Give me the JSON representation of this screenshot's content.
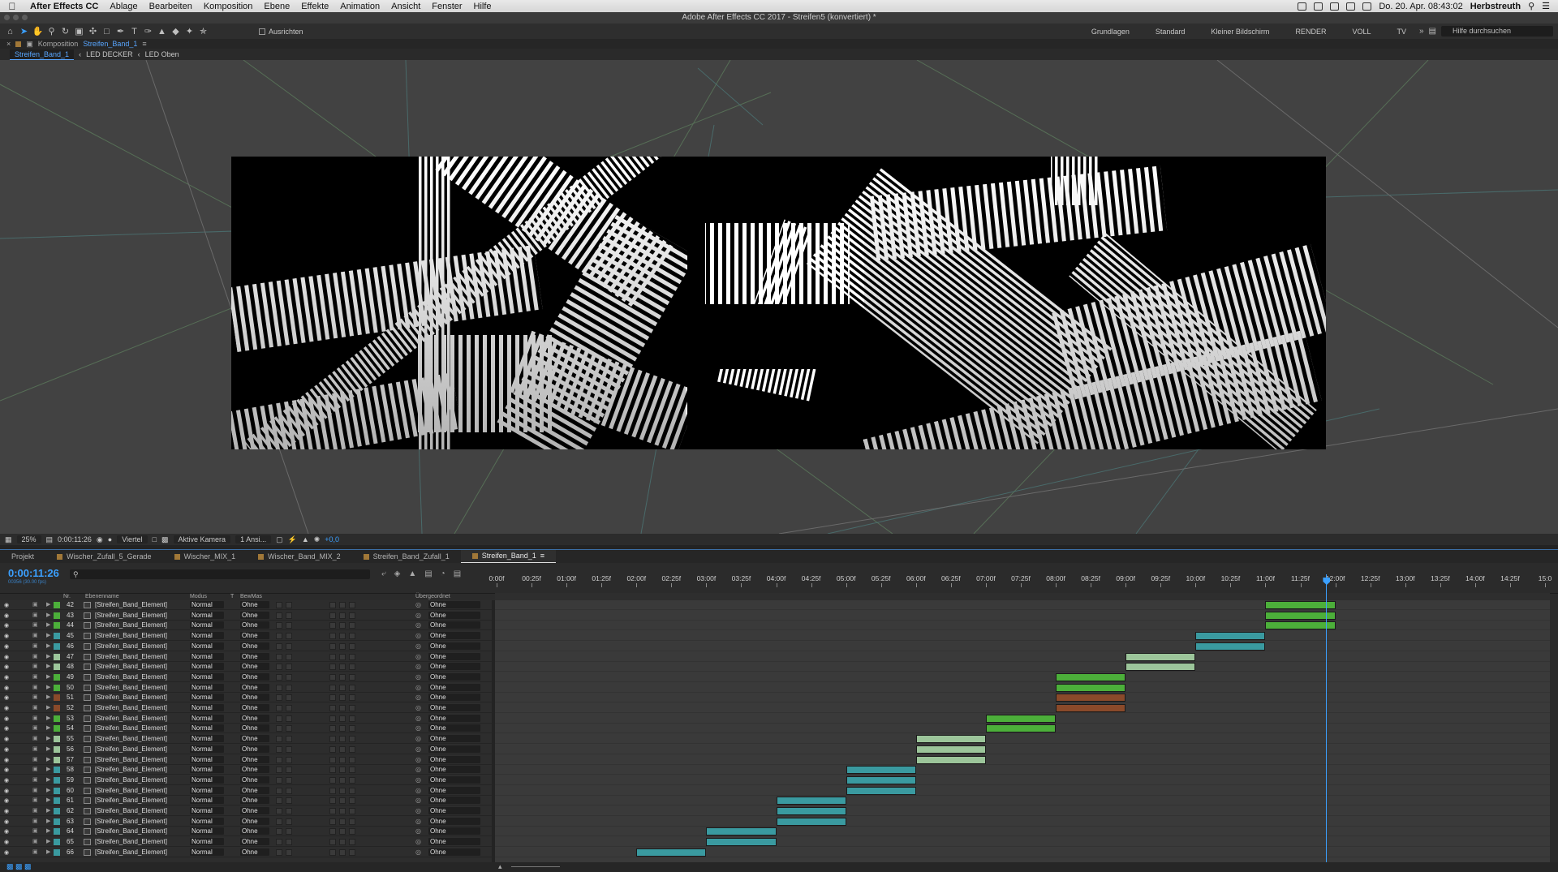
{
  "menubar": {
    "items": [
      "After Effects CC",
      "Ablage",
      "Bearbeiten",
      "Komposition",
      "Ebene",
      "Effekte",
      "Animation",
      "Ansicht",
      "Fenster",
      "Hilfe"
    ],
    "clock": "Do. 20. Apr.  08:43:02",
    "user": "Herbstreuth"
  },
  "window_title": "Adobe After Effects CC 2017 - Streifen5 (konvertiert) *",
  "toolbar": {
    "align_label": "Ausrichten",
    "workspaces": [
      "Grundlagen",
      "Standard",
      "Kleiner Bildschirm",
      "RENDER",
      "VOLL",
      "TV"
    ],
    "help_placeholder": "Hilfe durchsuchen"
  },
  "comp_panel": {
    "label": "Komposition",
    "name": "Streifen_Band_1",
    "breadcrumbs": [
      "Streifen_Band_1",
      "LED DECKER",
      "LED Oben"
    ]
  },
  "viewer_bar": {
    "zoom": "25%",
    "time": "0:00:11:26",
    "resolution": "Viertel",
    "camera": "Aktive Kamera",
    "views": "1 Ansi...",
    "exposure": "+0,0"
  },
  "timeline_tabs": [
    "Projekt",
    "Wischer_Zufall_5_Gerade",
    "Wischer_MIX_1",
    "Wischer_Band_MIX_2",
    "Streifen_Band_Zufall_1",
    "Streifen_Band_1"
  ],
  "timeline": {
    "timecode": "0:00:11:26",
    "timecode_sub": "00356 (30.00 fps)",
    "columns": {
      "nr": "Nr.",
      "name": "Ebenenname",
      "mode": "Modus",
      "t": "T",
      "trkmat": "BewMas",
      "parent": "Übergeordnet"
    },
    "ruler_labels": [
      "0:00f",
      "00:25f",
      "01:00f",
      "01:25f",
      "02:00f",
      "02:25f",
      "03:00f",
      "03:25f",
      "04:00f",
      "04:25f",
      "05:00f",
      "05:25f",
      "06:00f",
      "06:25f",
      "07:00f",
      "07:25f",
      "08:00f",
      "08:25f",
      "09:00f",
      "09:25f",
      "10:00f",
      "10:25f",
      "11:00f",
      "11:25f",
      "12:00f",
      "12:25f",
      "13:00f",
      "13:25f",
      "14:00f",
      "14:25f",
      "15:0"
    ],
    "playhead_seconds": 11.87,
    "duration_seconds": 15,
    "layers": [
      {
        "nr": "42",
        "name": "[Streifen_Band_Element]",
        "mode": "Normal",
        "trkmat": "Ohne",
        "parent": "Ohne",
        "color": "#4caf3a",
        "start": 11.0,
        "end": 12.0
      },
      {
        "nr": "43",
        "name": "[Streifen_Band_Element]",
        "mode": "Normal",
        "trkmat": "Ohne",
        "parent": "Ohne",
        "color": "#4caf3a",
        "start": 11.0,
        "end": 12.0
      },
      {
        "nr": "44",
        "name": "[Streifen_Band_Element]",
        "mode": "Normal",
        "trkmat": "Ohne",
        "parent": "Ohne",
        "color": "#4caf3a",
        "start": 11.0,
        "end": 12.0
      },
      {
        "nr": "45",
        "name": "[Streifen_Band_Element]",
        "mode": "Normal",
        "trkmat": "Ohne",
        "parent": "Ohne",
        "color": "#3a9aa0",
        "start": 10.0,
        "end": 11.0
      },
      {
        "nr": "46",
        "name": "[Streifen_Band_Element]",
        "mode": "Normal",
        "trkmat": "Ohne",
        "parent": "Ohne",
        "color": "#3a9aa0",
        "start": 10.0,
        "end": 11.0
      },
      {
        "nr": "47",
        "name": "[Streifen_Band_Element]",
        "mode": "Normal",
        "trkmat": "Ohne",
        "parent": "Ohne",
        "color": "#9cc59a",
        "start": 9.0,
        "end": 10.0
      },
      {
        "nr": "48",
        "name": "[Streifen_Band_Element]",
        "mode": "Normal",
        "trkmat": "Ohne",
        "parent": "Ohne",
        "color": "#9cc59a",
        "start": 9.0,
        "end": 10.0
      },
      {
        "nr": "49",
        "name": "[Streifen_Band_Element]",
        "mode": "Normal",
        "trkmat": "Ohne",
        "parent": "Ohne",
        "color": "#4caf3a",
        "start": 8.0,
        "end": 9.0
      },
      {
        "nr": "50",
        "name": "[Streifen_Band_Element]",
        "mode": "Normal",
        "trkmat": "Ohne",
        "parent": "Ohne",
        "color": "#4caf3a",
        "start": 8.0,
        "end": 9.0
      },
      {
        "nr": "51",
        "name": "[Streifen_Band_Element]",
        "mode": "Normal",
        "trkmat": "Ohne",
        "parent": "Ohne",
        "color": "#8a4a2a",
        "start": 8.0,
        "end": 9.0
      },
      {
        "nr": "52",
        "name": "[Streifen_Band_Element]",
        "mode": "Normal",
        "trkmat": "Ohne",
        "parent": "Ohne",
        "color": "#8a4a2a",
        "start": 8.0,
        "end": 9.0
      },
      {
        "nr": "53",
        "name": "[Streifen_Band_Element]",
        "mode": "Normal",
        "trkmat": "Ohne",
        "parent": "Ohne",
        "color": "#4caf3a",
        "start": 7.0,
        "end": 8.0
      },
      {
        "nr": "54",
        "name": "[Streifen_Band_Element]",
        "mode": "Normal",
        "trkmat": "Ohne",
        "parent": "Ohne",
        "color": "#4caf3a",
        "start": 7.0,
        "end": 8.0
      },
      {
        "nr": "55",
        "name": "[Streifen_Band_Element]",
        "mode": "Normal",
        "trkmat": "Ohne",
        "parent": "Ohne",
        "color": "#9cc59a",
        "start": 6.0,
        "end": 7.0
      },
      {
        "nr": "56",
        "name": "[Streifen_Band_Element]",
        "mode": "Normal",
        "trkmat": "Ohne",
        "parent": "Ohne",
        "color": "#9cc59a",
        "start": 6.0,
        "end": 7.0
      },
      {
        "nr": "57",
        "name": "[Streifen_Band_Element]",
        "mode": "Normal",
        "trkmat": "Ohne",
        "parent": "Ohne",
        "color": "#9cc59a",
        "start": 6.0,
        "end": 7.0
      },
      {
        "nr": "58",
        "name": "[Streifen_Band_Element]",
        "mode": "Normal",
        "trkmat": "Ohne",
        "parent": "Ohne",
        "color": "#3a9aa0",
        "start": 5.0,
        "end": 6.0
      },
      {
        "nr": "59",
        "name": "[Streifen_Band_Element]",
        "mode": "Normal",
        "trkmat": "Ohne",
        "parent": "Ohne",
        "color": "#3a9aa0",
        "start": 5.0,
        "end": 6.0
      },
      {
        "nr": "60",
        "name": "[Streifen_Band_Element]",
        "mode": "Normal",
        "trkmat": "Ohne",
        "parent": "Ohne",
        "color": "#3a9aa0",
        "start": 5.0,
        "end": 6.0
      },
      {
        "nr": "61",
        "name": "[Streifen_Band_Element]",
        "mode": "Normal",
        "trkmat": "Ohne",
        "parent": "Ohne",
        "color": "#3a9aa0",
        "start": 4.0,
        "end": 5.0
      },
      {
        "nr": "62",
        "name": "[Streifen_Band_Element]",
        "mode": "Normal",
        "trkmat": "Ohne",
        "parent": "Ohne",
        "color": "#3a9aa0",
        "start": 4.0,
        "end": 5.0
      },
      {
        "nr": "63",
        "name": "[Streifen_Band_Element]",
        "mode": "Normal",
        "trkmat": "Ohne",
        "parent": "Ohne",
        "color": "#3a9aa0",
        "start": 4.0,
        "end": 5.0
      },
      {
        "nr": "64",
        "name": "[Streifen_Band_Element]",
        "mode": "Normal",
        "trkmat": "Ohne",
        "parent": "Ohne",
        "color": "#3a9aa0",
        "start": 3.0,
        "end": 4.0
      },
      {
        "nr": "65",
        "name": "[Streifen_Band_Element]",
        "mode": "Normal",
        "trkmat": "Ohne",
        "parent": "Ohne",
        "color": "#3a9aa0",
        "start": 3.0,
        "end": 4.0
      },
      {
        "nr": "66",
        "name": "[Streifen_Band_Element]",
        "mode": "Normal",
        "trkmat": "Ohne",
        "parent": "Ohne",
        "color": "#3a9aa0",
        "start": 2.0,
        "end": 3.0
      }
    ]
  },
  "colors": {
    "accent": "#3ba0ff",
    "viewer_bg": "#424242",
    "comp_bg": "#000000"
  }
}
